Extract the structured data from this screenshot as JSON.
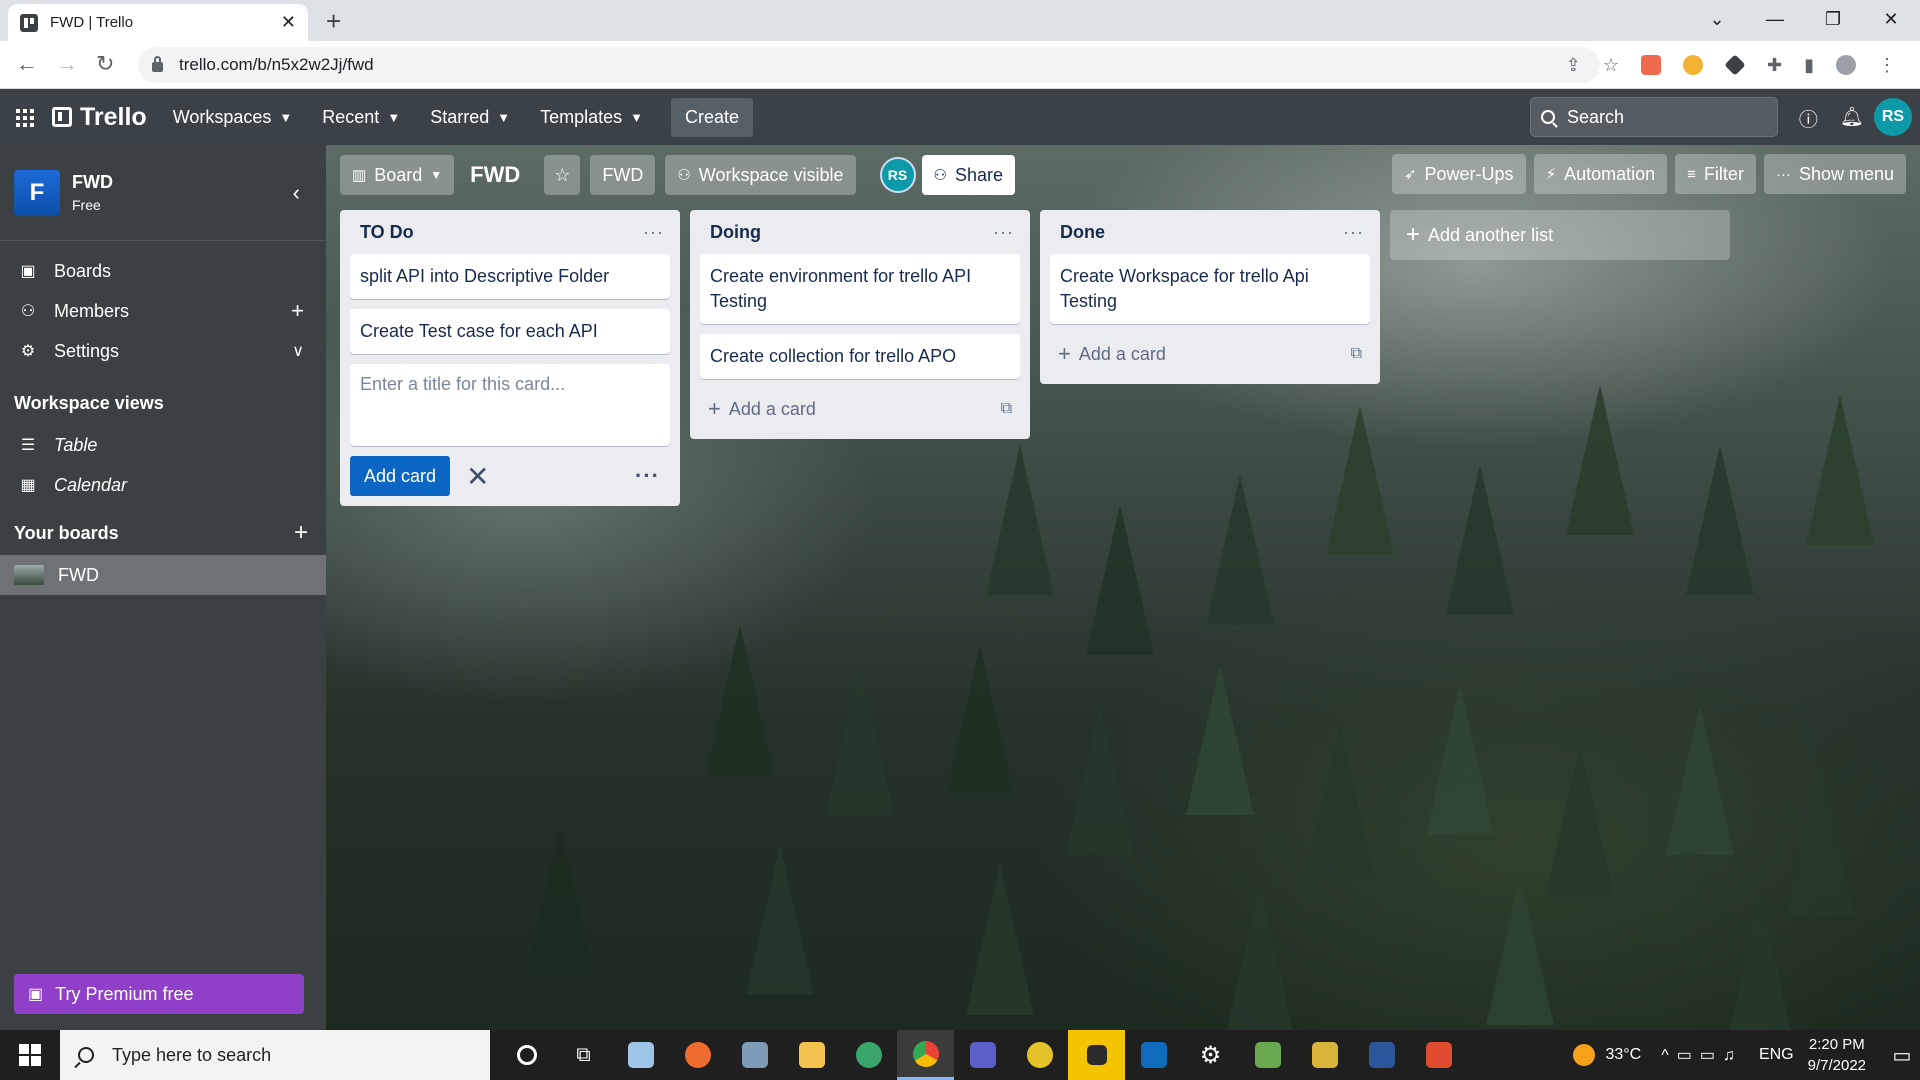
{
  "browser": {
    "tab_title": "FWD | Trello",
    "tab_close": "✕",
    "new_tab": "+",
    "url": "trello.com/b/n5x2w2Jj/fwd",
    "window_controls": [
      "⌄",
      "—",
      "❐",
      "✕"
    ]
  },
  "header": {
    "logo": "Trello",
    "menus": [
      {
        "label": "Workspaces"
      },
      {
        "label": "Recent"
      },
      {
        "label": "Starred"
      },
      {
        "label": "Templates"
      }
    ],
    "create": "Create",
    "search_placeholder": "Search",
    "avatar": "RS"
  },
  "sidebar": {
    "workspace_initial": "F",
    "workspace_name": "FWD",
    "workspace_plan": "Free",
    "items": [
      {
        "label": "Boards",
        "icon": "boards-icon"
      },
      {
        "label": "Members",
        "icon": "members-icon"
      },
      {
        "label": "Settings",
        "icon": "settings-icon"
      }
    ],
    "views_title": "Workspace views",
    "views": [
      {
        "label": "Table",
        "icon": "table-icon"
      },
      {
        "label": "Calendar",
        "icon": "calendar-icon"
      }
    ],
    "your_boards_title": "Your boards",
    "boards": [
      {
        "label": "FWD"
      }
    ],
    "premium": "Try Premium free"
  },
  "board": {
    "view_label": "Board",
    "title": "FWD",
    "workspace_chip": "FWD",
    "visibility": "Workspace visible",
    "member_avatar": "RS",
    "share": "Share",
    "right_buttons": [
      "Power-Ups",
      "Automation",
      "Filter",
      "Show menu"
    ]
  },
  "lists": [
    {
      "title": "TO Do",
      "cards": [
        "split API into Descriptive Folder",
        "Create Test case for each API"
      ],
      "composer": {
        "placeholder": "Enter a title for this card...",
        "add_label": "Add card"
      }
    },
    {
      "title": "Doing",
      "cards": [
        "Create environment for trello API Testing",
        "Create collection for trello APO"
      ],
      "add_card": "Add a card"
    },
    {
      "title": "Done",
      "cards": [
        "Create Workspace for trello Api Testing"
      ],
      "add_card": "Add a card"
    }
  ],
  "add_list": "Add another list",
  "taskbar": {
    "search_placeholder": "Type here to search",
    "temperature": "33°C",
    "language": "ENG",
    "time": "2:20 PM",
    "date": "9/7/2022"
  },
  "colors": {
    "header_bg": "#3a4147",
    "sidebar_bg": "#3b4043",
    "primary_button": "#0c66c4",
    "premium": "#8f3fc8",
    "avatar": "#0d9aa8"
  }
}
